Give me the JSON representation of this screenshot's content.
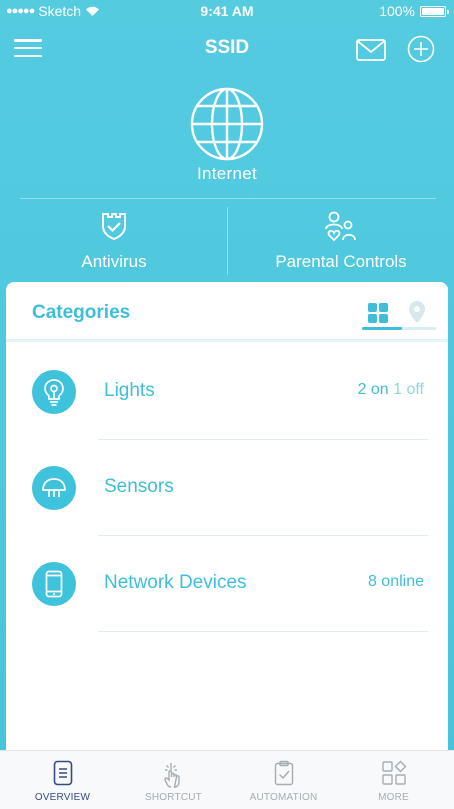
{
  "status_bar": {
    "signal_dots": "●●●●●",
    "carrier": "Sketch",
    "time": "9:41 AM",
    "battery": "100%"
  },
  "nav": {
    "title": "SSID",
    "icons": [
      "menu-icon",
      "mail-icon",
      "add-icon"
    ]
  },
  "hero": {
    "internet_label": "Internet",
    "features": [
      {
        "label": "Antivirus",
        "icon": "shield-icon"
      },
      {
        "label": "Parental Controls",
        "icon": "family-icon"
      }
    ]
  },
  "categories": {
    "title": "Categories",
    "view_toggle": {
      "active": "grid-view-icon",
      "inactive": "map-pin-icon"
    },
    "items": [
      {
        "label": "Lights",
        "icon": "bulb-icon",
        "status_on": "2 on",
        "status_off": "1 off"
      },
      {
        "label": "Sensors",
        "icon": "sensor-icon",
        "status": ""
      },
      {
        "label": "Network Devices",
        "icon": "phone-icon",
        "status": "8 online"
      }
    ]
  },
  "tabs": [
    {
      "label": "OVERVIEW",
      "icon": "overview-icon",
      "active": true
    },
    {
      "label": "SHORTCUT",
      "icon": "tap-icon",
      "active": false
    },
    {
      "label": "AUTOMATION",
      "icon": "clipboard-check-icon",
      "active": false
    },
    {
      "label": "MORE",
      "icon": "more-grid-icon",
      "active": false
    }
  ],
  "colors": {
    "accent": "#3fbed8",
    "header_bg": "#4ac6dd",
    "tab_active": "#3a4a84",
    "tab_inactive": "#a5adb2"
  }
}
